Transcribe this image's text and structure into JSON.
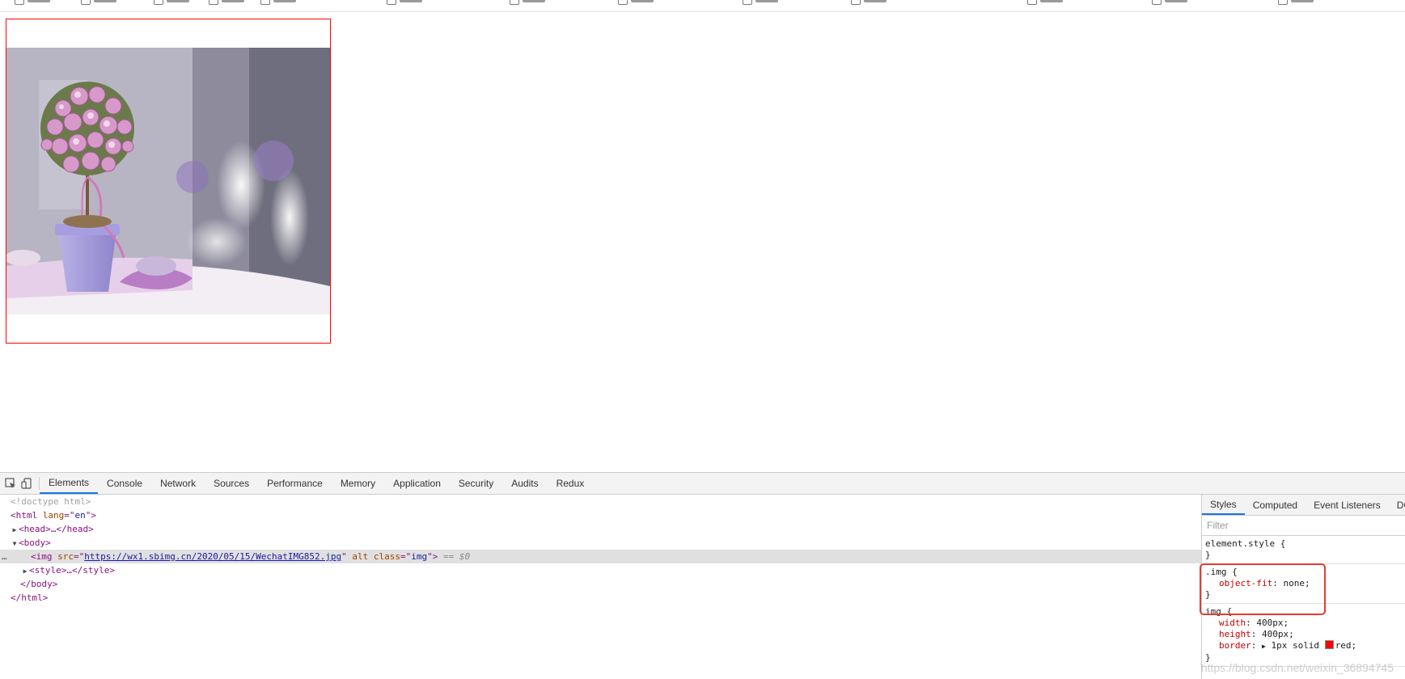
{
  "devtools": {
    "tabs": [
      "Elements",
      "Console",
      "Network",
      "Sources",
      "Performance",
      "Memory",
      "Application",
      "Security",
      "Audits",
      "Redux"
    ],
    "active_tab": "Elements"
  },
  "dom": {
    "doctype": "<!doctype html>",
    "html_open_tag": "html",
    "html_attr_name": "lang",
    "html_attr_value": "en",
    "head_collapsed": "<head>…</head>",
    "body_open": "<body>",
    "img_tag": "img",
    "img_src_attr": "src",
    "img_src_value": "https://wx1.sbimg.cn/2020/05/15/WechatIMG852.jpg",
    "img_alt_attr": "alt",
    "img_class_attr": "class",
    "img_class_value": "img",
    "selected_marker": "== $0",
    "style_collapsed": "<style>…</style>",
    "body_close": "</body>",
    "html_close": "</html>"
  },
  "styles_pane": {
    "tabs": [
      "Styles",
      "Computed",
      "Event Listeners",
      "DOM"
    ],
    "filter_placeholder": "Filter",
    "element_style_selector": "element.style {",
    "close_brace": "}",
    "rule_img_class_selector": ".img {",
    "rule_img_class_prop": "object-fit",
    "rule_img_class_value": "none;",
    "rule_img_selector": "img {",
    "width_prop": "width",
    "width_value": "400px;",
    "height_prop": "height",
    "height_value": "400px;",
    "border_prop": "border",
    "border_value_prefix": "1px solid",
    "border_value_color": "red;"
  },
  "watermark": "https://blog.csdn.net/weixin_36894745",
  "colors": {
    "accent": "#1a73e8",
    "highlight_box": "#e43c2f",
    "img_border": "#ff0000"
  }
}
